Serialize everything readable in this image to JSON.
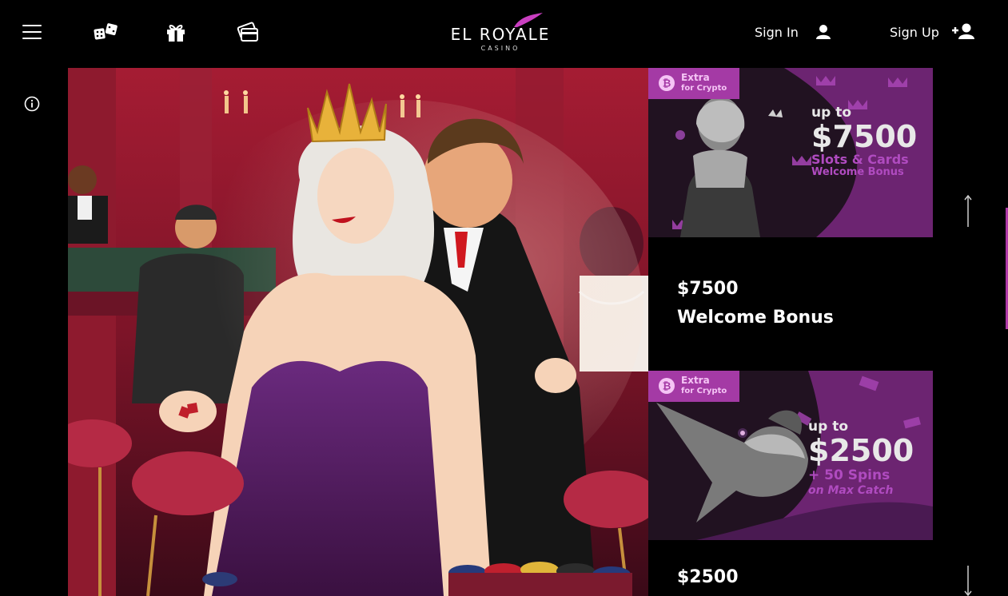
{
  "header": {
    "menu_icon": "hamburger-menu-icon",
    "icons": [
      "dice-icon",
      "gift-icon",
      "cards-icon"
    ],
    "logo": {
      "main": "EL ROYALE",
      "sub": "CASINO"
    },
    "sign_in_label": "Sign In",
    "sign_up_label": "Sign Up"
  },
  "sidebar": {
    "info_icon": "info-icon"
  },
  "promos": [
    {
      "tag_line1": "Extra",
      "tag_line2": "for Crypto",
      "banner_line1": "up to",
      "banner_amount": "$7500",
      "banner_line2": "Slots & Cards",
      "banner_line3": "Welcome Bonus",
      "title_line1": "$7500",
      "title_line2": "Welcome Bonus"
    },
    {
      "tag_line1": "Extra",
      "tag_line2": "for Crypto",
      "banner_line1": "up to",
      "banner_amount": "$2500",
      "banner_line2": "+ 50 Spins",
      "banner_line3": "on Max Catch",
      "title_line1": "$2500"
    }
  ],
  "colors": {
    "background": "#000000",
    "accent_purple": "#a43aa5",
    "banner_text": "#e8e8e8",
    "banner_accent": "#a845b5"
  }
}
